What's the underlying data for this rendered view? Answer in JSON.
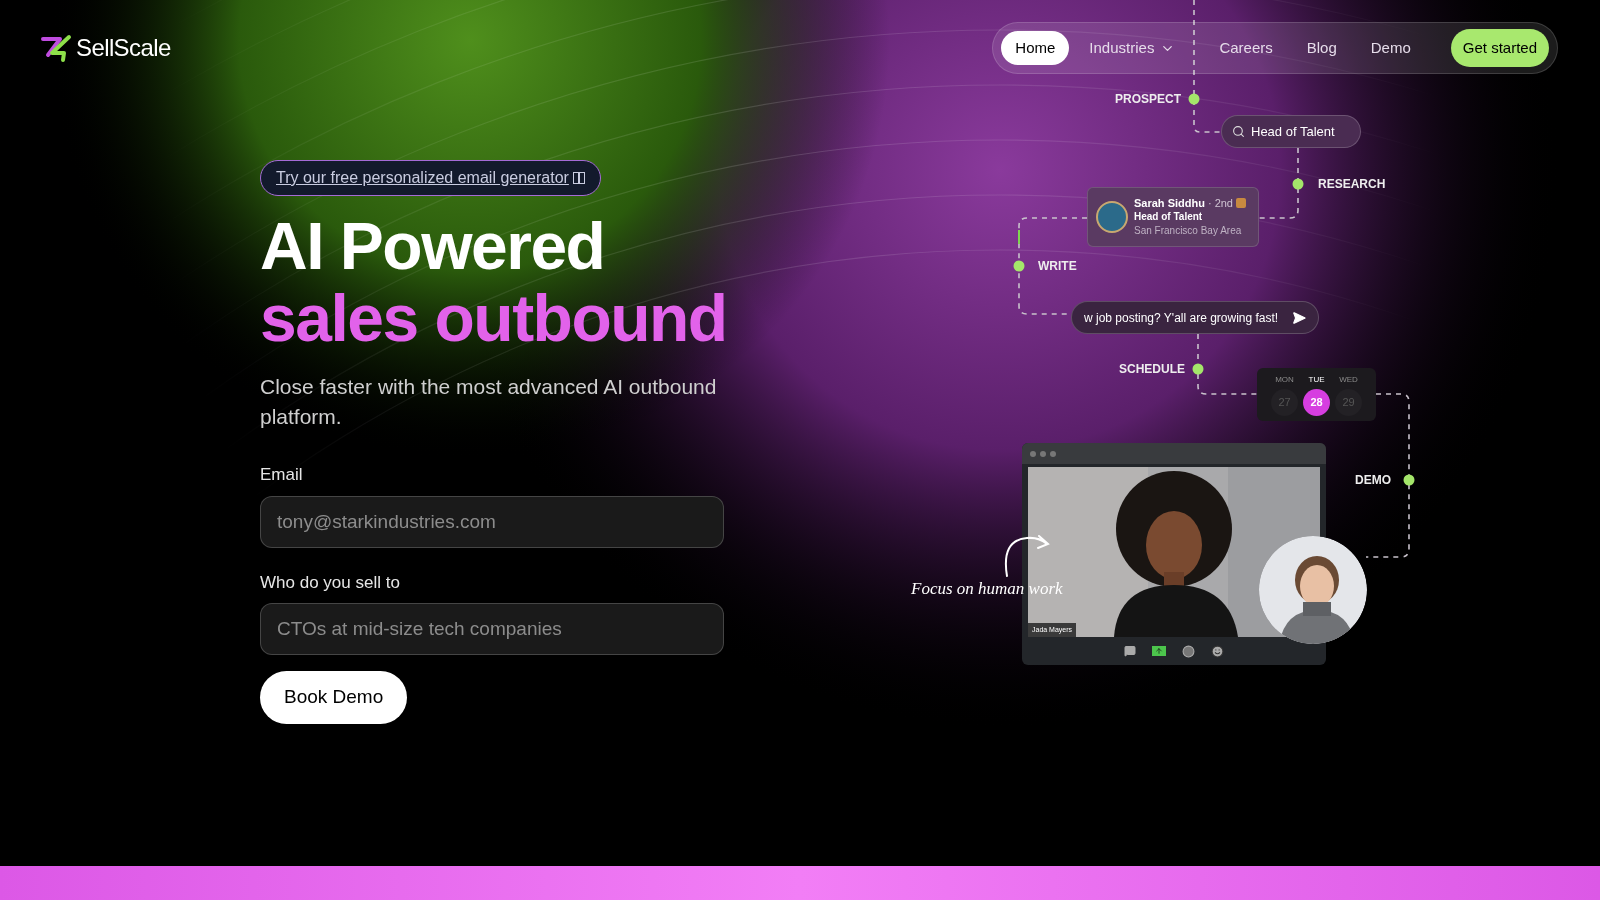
{
  "header": {
    "logo": "SellScale",
    "nav": [
      {
        "label": "Home",
        "selected": true,
        "kind": "link"
      },
      {
        "label": "Industries",
        "selected": false,
        "kind": "dropdown"
      },
      {
        "label": "Careers",
        "selected": false,
        "kind": "link"
      },
      {
        "label": "Blog",
        "selected": false,
        "kind": "link"
      },
      {
        "label": "Demo",
        "selected": false,
        "kind": "link"
      }
    ],
    "cta": "Get started"
  },
  "hero": {
    "badge": "Try our free personalized email generator",
    "title_line_1": "AI Powered",
    "title_line_2": "sales outbound",
    "subtitle": "Close faster with the most advanced AI outbound platform.",
    "fields": [
      {
        "label": "Email",
        "placeholder": "tony@starkindustries.com"
      },
      {
        "label": "Who do you sell to",
        "placeholder": "CTOs at mid-size tech companies"
      }
    ],
    "button": "Book Demo"
  },
  "illustration": {
    "steps": [
      "PROSPECT",
      "RESEARCH",
      "WRITE",
      "SCHEDULE",
      "DEMO"
    ],
    "search": "Head of Talent",
    "profile": {
      "name": "Sarah Siddhu",
      "degree": "· 2nd",
      "title": "Head of Talent",
      "location": "San Francisco Bay Area"
    },
    "message": "w job posting? Y'all are growing fast!",
    "calendar": [
      {
        "day": "MON",
        "date": "27",
        "selected": false
      },
      {
        "day": "TUE",
        "date": "28",
        "selected": true
      },
      {
        "day": "WED",
        "date": "29",
        "selected": false
      }
    ],
    "video_caption": "Jada Mayers",
    "annotation": "Focus on human work"
  }
}
